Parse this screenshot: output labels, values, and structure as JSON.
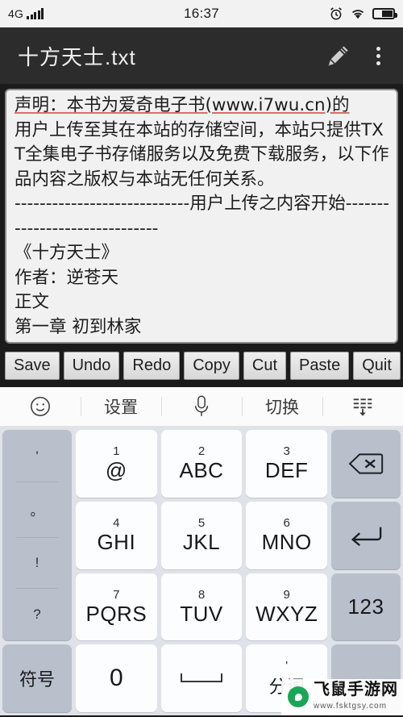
{
  "statusbar": {
    "network": "4G",
    "clock": "16:37",
    "icons": [
      "signal-bars",
      "alarm-clock-icon",
      "wifi-icon",
      "battery-icon"
    ]
  },
  "titlebar": {
    "title": "十方天士.txt",
    "edit_icon": "pencil-icon",
    "menu_icon": "kebab-menu-icon"
  },
  "editor": {
    "lines": [
      "声明：本书为爱奇电子书(www.i7wu.cn)的",
      "用户上传至其在本站的存储空间，本站只提供TXT全集电子书存储服务以及免费下载服务，以下作品内容之版权与本站无任何关系。",
      "----------------------------用户上传之内容开始------------------------------",
      "《十方天士》",
      "作者：逆苍天",
      "正文",
      "第一章 初到林家"
    ]
  },
  "actionbar": {
    "buttons": [
      "Save",
      "Undo",
      "Redo",
      "Copy",
      "Cut",
      "Paste",
      "Quit"
    ]
  },
  "imebar": {
    "items": [
      {
        "label": "",
        "icon": "smiley-icon"
      },
      {
        "label": "设置",
        "icon": ""
      },
      {
        "label": "",
        "icon": "microphone-icon"
      },
      {
        "label": "切换",
        "icon": ""
      },
      {
        "label": "",
        "icon": "hide-keyboard-icon"
      }
    ]
  },
  "keyboard": {
    "punct_key": {
      "marks": [
        "'",
        "。",
        "!",
        "?"
      ]
    },
    "keys": [
      {
        "sub": "1",
        "main": "@"
      },
      {
        "sub": "2",
        "main": "ABC"
      },
      {
        "sub": "3",
        "main": "DEF"
      },
      {
        "sub": "4",
        "main": "GHI"
      },
      {
        "sub": "5",
        "main": "JKL"
      },
      {
        "sub": "6",
        "main": "MNO"
      },
      {
        "sub": "7",
        "main": "PQRS"
      },
      {
        "sub": "8",
        "main": "TUV"
      },
      {
        "sub": "9",
        "main": "WXYZ"
      }
    ],
    "symbol_key": "符号",
    "zero_key": "0",
    "space_key": "",
    "split_key": {
      "sub": "'",
      "main": "分词"
    },
    "backspace_key": "backspace-icon",
    "enter_key": "enter-icon",
    "num_mode_key": "123",
    "lang_key": ""
  },
  "watermark": {
    "main": "飞鼠手游网",
    "sub": "www.fsktgsy.com"
  },
  "colors": {
    "titlebar_bg": "#2c2c2c",
    "editor_bg": "#f1f1f1",
    "keyboard_bg": "#dfe2e8",
    "fn_key_bg": "#b9c0cc",
    "num_key_bg": "#fcfdfe",
    "spell_underline": "#e06b6b",
    "watermark_green": "#1aa658"
  }
}
